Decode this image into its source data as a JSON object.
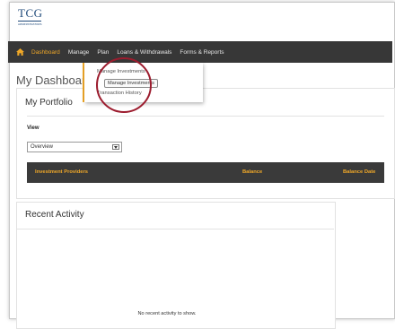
{
  "logo": {
    "text": "TCG",
    "subtitle": "ADMINISTRATORS"
  },
  "nav": {
    "items": [
      {
        "label": "Dashboard",
        "active": true
      },
      {
        "label": "Manage",
        "active": false
      },
      {
        "label": "Plan",
        "active": false
      },
      {
        "label": "Loans & Withdrawals",
        "active": false
      },
      {
        "label": "Forms & Reports",
        "active": false
      }
    ]
  },
  "dropdown": {
    "items": [
      "Manage Investments",
      "Transaction History"
    ],
    "tooltip": "Manage Investments"
  },
  "page": {
    "title": "My Dashboard"
  },
  "portfolio": {
    "title": "My Portfolio",
    "view_label": "View",
    "select_value": "Overview",
    "columns": [
      "Investment Providers",
      "Balance",
      "Balance Date"
    ]
  },
  "activity": {
    "title": "Recent Activity",
    "empty_text": "No recent activity to show."
  },
  "colors": {
    "accent": "#f0a828",
    "navbar": "#373737",
    "highlight_circle": "#9c1c2e",
    "brand": "#1f4a7a"
  }
}
